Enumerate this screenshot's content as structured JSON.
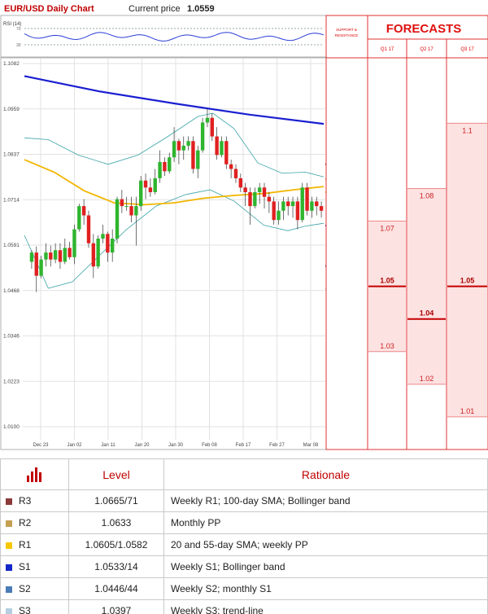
{
  "header": {
    "title": "EUR/USD Daily Chart",
    "price_label": "Current price",
    "price_value": "1.0559"
  },
  "rsi": {
    "label": "RSI (14)",
    "ticks": [
      "70",
      "30"
    ]
  },
  "chart_data": {
    "type": "candlestick",
    "title": "EUR/USD Daily Chart",
    "ylim": [
      1.01,
      1.0882
    ],
    "y_ticks": [
      "1.1082",
      "1.0959",
      "1.0837",
      "1.0714",
      "1.0591",
      "1.0468",
      "1.0346",
      "1.0223",
      "1.0100"
    ],
    "x_ticks": [
      "Dec 23",
      "Jan 02",
      "Jan 11",
      "Jan 20",
      "Jan 30",
      "Feb 08",
      "Feb 17",
      "Feb 27",
      "Mar 08"
    ],
    "candles": [
      [
        1.0455,
        1.0475,
        1.044,
        1.048
      ],
      [
        1.0475,
        1.0425,
        1.039,
        1.0488
      ],
      [
        1.0425,
        1.046,
        1.042,
        1.0468
      ],
      [
        1.046,
        1.0475,
        1.0445,
        1.0495
      ],
      [
        1.0475,
        1.046,
        1.0445,
        1.049
      ],
      [
        1.046,
        1.048,
        1.0452,
        1.0495
      ],
      [
        1.048,
        1.0455,
        1.044,
        1.0495
      ],
      [
        1.0455,
        1.0485,
        1.045,
        1.0505
      ],
      [
        1.0485,
        1.0465,
        1.046,
        1.0498
      ],
      [
        1.0465,
        1.0525,
        1.045,
        1.0535
      ],
      [
        1.0525,
        1.0575,
        1.052,
        1.058
      ],
      [
        1.0575,
        1.0555,
        1.0535,
        1.059
      ],
      [
        1.0555,
        1.0495,
        1.0485,
        1.0565
      ],
      [
        1.0495,
        1.0445,
        1.042,
        1.0515
      ],
      [
        1.0445,
        1.0505,
        1.044,
        1.0512
      ],
      [
        1.0505,
        1.0515,
        1.0495,
        1.0535
      ],
      [
        1.0515,
        1.0475,
        1.0455,
        1.052
      ],
      [
        1.0475,
        1.0505,
        1.0455,
        1.0525
      ],
      [
        1.0505,
        1.059,
        1.0495,
        1.0595
      ],
      [
        1.059,
        1.0575,
        1.056,
        1.061
      ],
      [
        1.0575,
        1.0575,
        1.0565,
        1.0595
      ],
      [
        1.0575,
        1.0555,
        1.054,
        1.0595
      ],
      [
        1.0555,
        1.0575,
        1.049,
        1.0595
      ],
      [
        1.0575,
        1.063,
        1.0565,
        1.064
      ],
      [
        1.063,
        1.0615,
        1.059,
        1.0645
      ],
      [
        1.0615,
        1.0605,
        1.0595,
        1.0635
      ],
      [
        1.0605,
        1.0635,
        1.06,
        1.0655
      ],
      [
        1.0635,
        1.067,
        1.0625,
        1.0695
      ],
      [
        1.067,
        1.065,
        1.064,
        1.068
      ],
      [
        1.065,
        1.068,
        1.0645,
        1.069
      ],
      [
        1.068,
        1.0715,
        1.067,
        1.0745
      ],
      [
        1.0715,
        1.0695,
        1.0665,
        1.072
      ],
      [
        1.0695,
        1.0705,
        1.0675,
        1.0725
      ],
      [
        1.0705,
        1.0715,
        1.0695,
        1.0725
      ],
      [
        1.0715,
        1.0655,
        1.0645,
        1.0725
      ],
      [
        1.0655,
        1.0695,
        1.0635,
        1.0705
      ],
      [
        1.0695,
        1.0755,
        1.069,
        1.0765
      ],
      [
        1.0755,
        1.0765,
        1.0745,
        1.0785
      ],
      [
        1.0765,
        1.0725,
        1.0715,
        1.0775
      ],
      [
        1.0725,
        1.0685,
        1.0675,
        1.0745
      ],
      [
        1.0685,
        1.0715,
        1.068,
        1.0725
      ],
      [
        1.0715,
        1.0665,
        1.0655,
        1.0725
      ],
      [
        1.0665,
        1.0655,
        1.0635,
        1.0675
      ],
      [
        1.0655,
        1.0635,
        1.0625,
        1.0665
      ],
      [
        1.0635,
        1.0615,
        1.0605,
        1.0645
      ],
      [
        1.0615,
        1.0605,
        1.0575,
        1.0625
      ],
      [
        1.0605,
        1.0575,
        1.0535,
        1.0615
      ],
      [
        1.0575,
        1.0605,
        1.057,
        1.0615
      ],
      [
        1.0605,
        1.0615,
        1.058,
        1.0625
      ],
      [
        1.0615,
        1.0595,
        1.057,
        1.0625
      ],
      [
        1.0595,
        1.0585,
        1.056,
        1.0605
      ],
      [
        1.0585,
        1.0545,
        1.0535,
        1.0595
      ],
      [
        1.0545,
        1.0565,
        1.0535,
        1.0585
      ],
      [
        1.0565,
        1.0585,
        1.0545,
        1.0595
      ],
      [
        1.0585,
        1.0575,
        1.0555,
        1.0595
      ],
      [
        1.0575,
        1.0585,
        1.055,
        1.0595
      ],
      [
        1.0585,
        1.0545,
        1.0525,
        1.0595
      ],
      [
        1.0545,
        1.0615,
        1.054,
        1.0625
      ],
      [
        1.0615,
        1.0565,
        1.0555,
        1.0625
      ],
      [
        1.0565,
        1.0585,
        1.055,
        1.0595
      ],
      [
        1.0585,
        1.0575,
        1.0555,
        1.0595
      ],
      [
        1.0575,
        1.0565,
        1.055,
        1.0585
      ]
    ],
    "sma_200": [
      [
        0,
        1.0855
      ],
      [
        0.25,
        1.0822
      ],
      [
        0.5,
        1.0796
      ],
      [
        0.75,
        1.0772
      ],
      [
        1,
        1.0752
      ]
    ],
    "sma_yellow": [
      [
        0,
        1.0675
      ],
      [
        0.1,
        1.0648
      ],
      [
        0.2,
        1.0608
      ],
      [
        0.3,
        1.0582
      ],
      [
        0.4,
        1.0578
      ],
      [
        0.5,
        1.0582
      ],
      [
        0.6,
        1.0592
      ],
      [
        0.7,
        1.0598
      ],
      [
        0.8,
        1.0602
      ],
      [
        0.9,
        1.061
      ],
      [
        1,
        1.0617
      ]
    ],
    "bb_upper": [
      [
        0,
        1.0722
      ],
      [
        0.08,
        1.0718
      ],
      [
        0.18,
        1.0685
      ],
      [
        0.28,
        1.0665
      ],
      [
        0.38,
        1.0685
      ],
      [
        0.48,
        1.0725
      ],
      [
        0.58,
        1.0768
      ],
      [
        0.63,
        1.0775
      ],
      [
        0.7,
        1.0742
      ],
      [
        0.78,
        1.0668
      ],
      [
        0.86,
        1.0646
      ],
      [
        0.94,
        1.0648
      ],
      [
        1,
        1.0638
      ]
    ],
    "bb_lower": [
      [
        0,
        1.0512
      ],
      [
        0.08,
        1.0398
      ],
      [
        0.16,
        1.0412
      ],
      [
        0.24,
        1.0462
      ],
      [
        0.34,
        1.0524
      ],
      [
        0.44,
        1.0575
      ],
      [
        0.54,
        1.06
      ],
      [
        0.62,
        1.061
      ],
      [
        0.7,
        1.0586
      ],
      [
        0.8,
        1.0534
      ],
      [
        0.88,
        1.0522
      ],
      [
        0.94,
        1.0532
      ],
      [
        1,
        1.0538
      ]
    ],
    "levels": [
      {
        "value": 1.0665,
        "label": "1.0665",
        "color": "#7b1f2c"
      },
      {
        "value": 1.0633,
        "label": "1.0633",
        "color": "#c5a16b"
      },
      {
        "value": 1.0605,
        "label": "1.0605",
        "color": "#f4b400"
      },
      {
        "value": 1.0533,
        "label": "1.0533",
        "color": "#1a28c9"
      },
      {
        "value": 1.0446,
        "label": "1.0446",
        "color": "#1f5aa3"
      },
      {
        "value": 1.0397,
        "label": "1.0397",
        "color": "#a7c7d6"
      }
    ]
  },
  "forecasts": {
    "title": "FORECASTS",
    "sr_label": [
      "SUPPORT &",
      "RESISTANCE"
    ],
    "columns": [
      {
        "name": "Q1 17",
        "top": "1.07",
        "mid": "1.05",
        "bottom": "1.03",
        "top_v": 1.07,
        "mid_v": 1.05,
        "bottom_v": 1.03
      },
      {
        "name": "Q2 17",
        "top": "1.08",
        "mid": "1.04",
        "bottom": "1.02",
        "top_v": 1.08,
        "mid_v": 1.04,
        "bottom_v": 1.02
      },
      {
        "name": "Q3 17",
        "top": "1.1",
        "mid": "1.05",
        "bottom": "1.01",
        "top_v": 1.1,
        "mid_v": 1.05,
        "bottom_v": 1.01
      }
    ]
  },
  "table": {
    "col_level": "Level",
    "col_rationale": "Rationale",
    "rows": [
      {
        "name": "R3",
        "color": "#8b3a3a",
        "level": "1.0665/71",
        "rationale": "Weekly R1; 100-day SMA; Bollinger band"
      },
      {
        "name": "R2",
        "color": "#c5a052",
        "level": "1.0633",
        "rationale": "Monthly PP"
      },
      {
        "name": "R1",
        "color": "#f7c800",
        "level": "1.0605/1.0582",
        "rationale": "20 and 55-day SMA; weekly PP"
      },
      {
        "name": "S1",
        "color": "#1427c8",
        "level": "1.0533/14",
        "rationale": "Weekly S1; Bollinger band"
      },
      {
        "name": "S2",
        "color": "#4a7bb7",
        "level": "1.0446/44",
        "rationale": "Weekly S2; monthly S1"
      },
      {
        "name": "S3",
        "color": "#b5cfe0",
        "level": "1.0397",
        "rationale": "Weekly S3; trend-line"
      }
    ]
  }
}
